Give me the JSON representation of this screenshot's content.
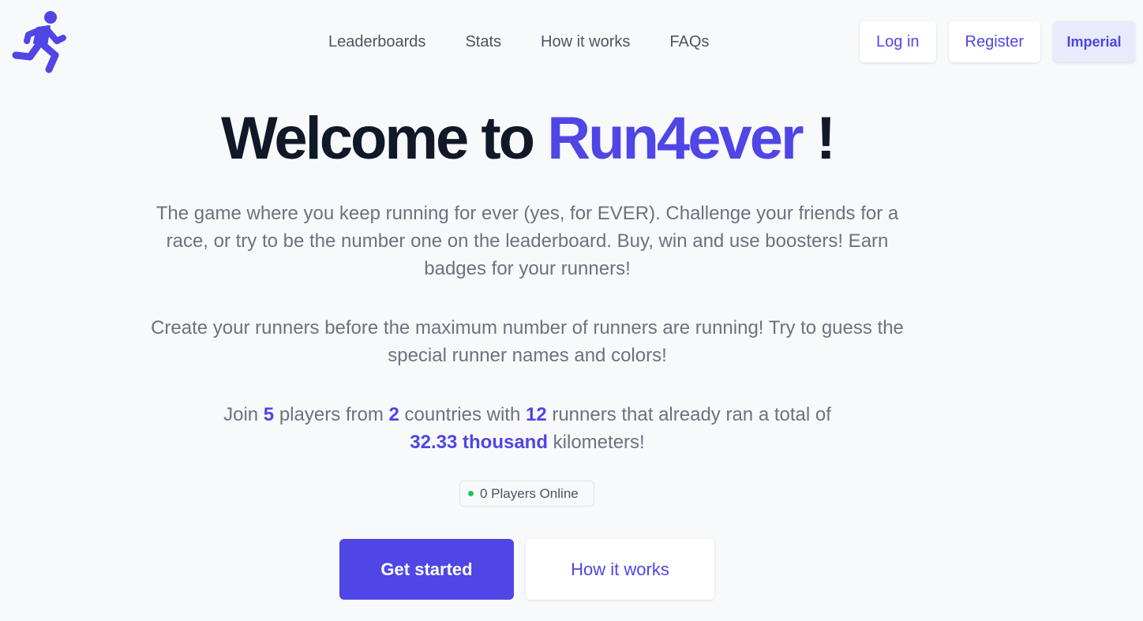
{
  "colors": {
    "accent": "#4f46e5",
    "title": "#111827",
    "body_text": "#6b7280",
    "online_dot": "#22c55e",
    "background": "#f8f9fb"
  },
  "logo": {
    "icon": "running-person-icon"
  },
  "nav": [
    {
      "label": "Leaderboards"
    },
    {
      "label": "Stats"
    },
    {
      "label": "How it works"
    },
    {
      "label": "FAQs"
    }
  ],
  "auth": {
    "login_label": "Log in",
    "register_label": "Register",
    "units_label": "Imperial"
  },
  "hero": {
    "title_prefix": "Welcome to ",
    "title_brand": "Run4ever",
    "title_suffix": " !",
    "paragraph1": "The game where you keep running for ever (yes, for EVER). Challenge your friends for a race, or try to be the number one on the leaderboard. Buy, win and use boosters! Earn badges for your runners!",
    "paragraph2": "Create your runners before the maximum number of runners are running! Try to guess the special runner names and colors!"
  },
  "stats": {
    "join_text": "Join ",
    "players": "5",
    "players_text": " players from ",
    "countries": "2",
    "countries_text": " countries with ",
    "runners": "12",
    "runners_text": " runners that already ran a total of ",
    "distance": "32.33 thousand",
    "distance_text": " kilometers!"
  },
  "online": {
    "label": "0 Players Online"
  },
  "cta": {
    "primary_label": "Get started",
    "secondary_label": "How it works"
  }
}
